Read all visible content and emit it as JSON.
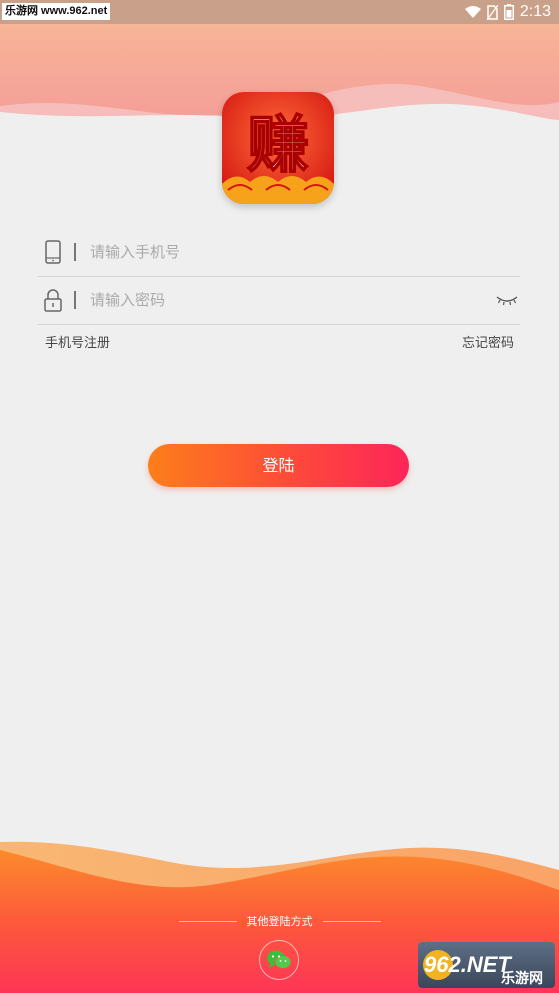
{
  "status_bar": {
    "watermark": "乐游网 www.962.net",
    "time": "2:13"
  },
  "logo": {
    "char": "赚"
  },
  "phone": {
    "placeholder": "请输入手机号",
    "value": ""
  },
  "password": {
    "placeholder": "请输入密码",
    "value": ""
  },
  "links": {
    "register": "手机号注册",
    "forgot": "忘记密码"
  },
  "login_button": "登陆",
  "other_login": {
    "label": "其他登陆方式"
  },
  "watermark_badge": {
    "brand": "962.NET",
    "sub": "乐游网"
  },
  "colors": {
    "accent_start": "#fd7e1a",
    "accent_end": "#fd2558",
    "background": "#efefef",
    "wechat_green": "#3ebd3a"
  }
}
